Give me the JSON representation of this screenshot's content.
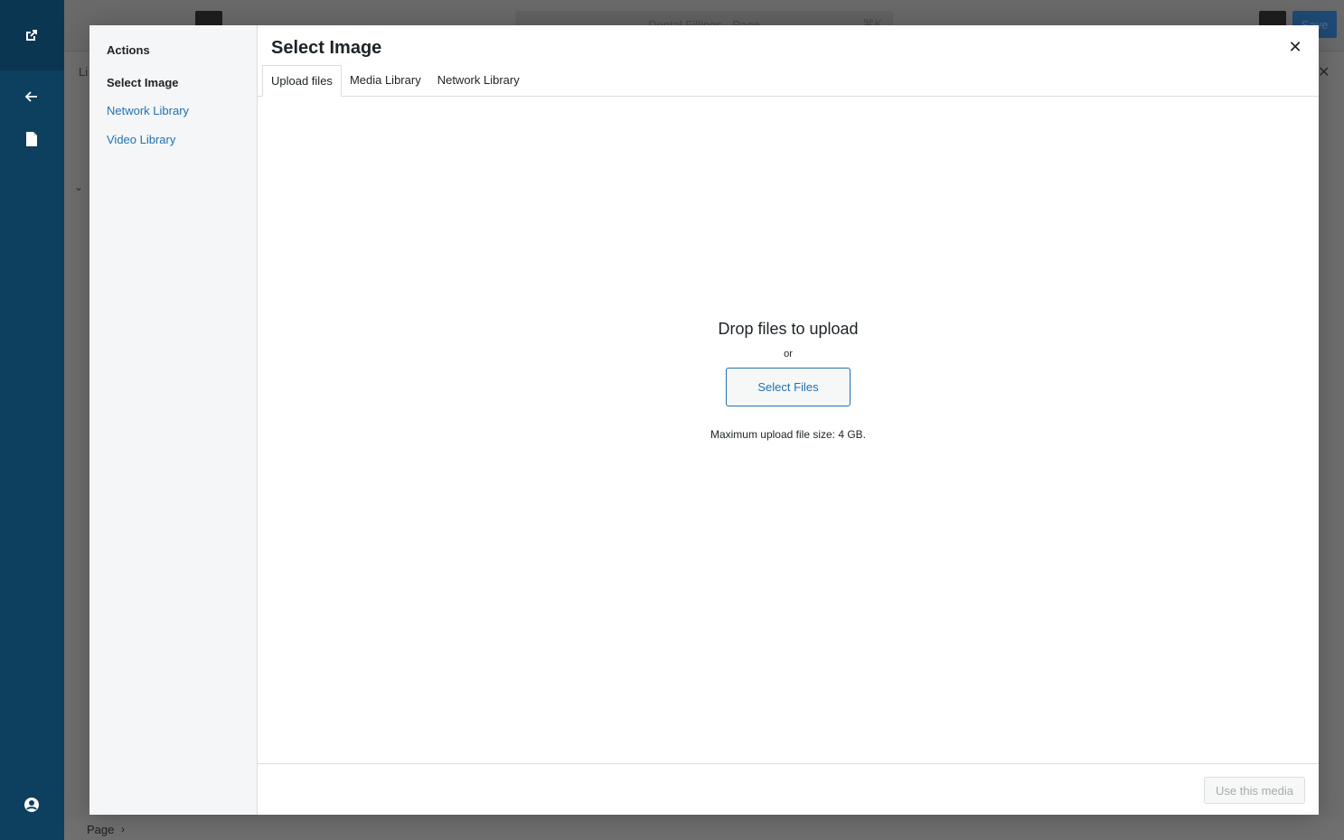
{
  "background": {
    "doc_title": "Dental Fillings · Page",
    "doc_shortcut": "⌘K",
    "save_label": "Save",
    "panel_tab_text": "Li",
    "breadcrumb": "Page",
    "breadcrumb_chevron": "›"
  },
  "rail": {
    "icons": [
      "external-link-icon",
      "arrow-left-icon",
      "page-icon",
      "user-icon"
    ]
  },
  "modal": {
    "menu": {
      "heading": "Actions",
      "items": [
        {
          "label": "Select Image",
          "active": true
        },
        {
          "label": "Network Library",
          "active": false
        },
        {
          "label": "Video Library",
          "active": false
        }
      ]
    },
    "title": "Select Image",
    "close_glyph": "✕",
    "tabs": [
      {
        "label": "Upload files",
        "active": true
      },
      {
        "label": "Media Library",
        "active": false
      },
      {
        "label": "Network Library",
        "active": false
      }
    ],
    "uploader": {
      "drop_text": "Drop files to upload",
      "or_text": "or",
      "button_label": "Select Files",
      "max_size": "Maximum upload file size: 4 GB."
    },
    "toolbar": {
      "use_media_label": "Use this media"
    }
  },
  "colors": {
    "accent": "#2271b1",
    "rail": "#0d3f5e",
    "overlay": "#6e6e6e"
  }
}
